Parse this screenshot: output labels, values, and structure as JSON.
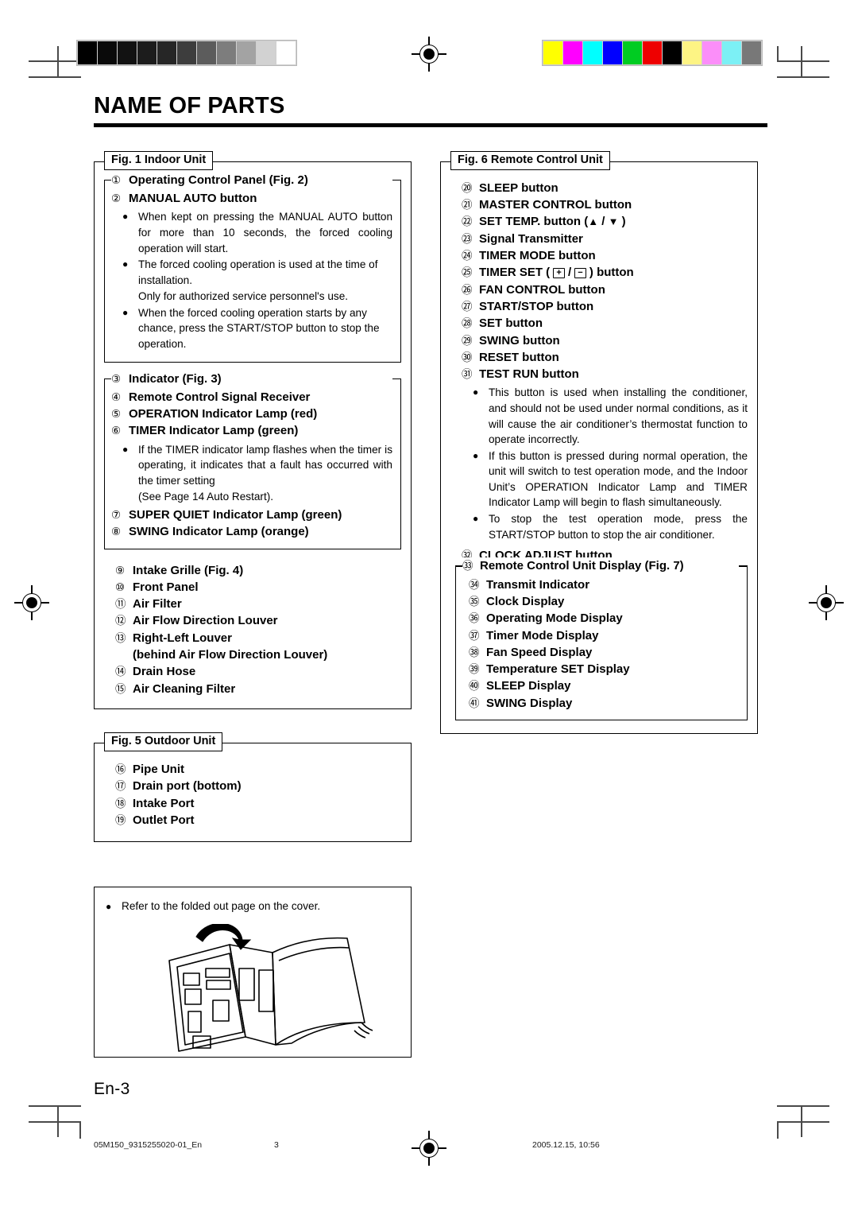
{
  "page": {
    "title": "NAME OF PARTS",
    "folio": "En-3"
  },
  "print_marks": {
    "grayscale_bar": [
      "#000000",
      "#0a0a0a",
      "#121212",
      "#1c1c1c",
      "#262626",
      "#3d3d3d",
      "#5c5c5c",
      "#7d7d7d",
      "#a3a3a3",
      "#d2d2d2",
      "#ffffff"
    ],
    "color_bar": [
      "#ffff00",
      "#ff00ff",
      "#00ffff",
      "#0000ff",
      "#00cc22",
      "#ee0000",
      "#000000",
      "#fdf484",
      "#fb8ef9",
      "#7cf0f5",
      "#787878"
    ],
    "registration_mark": "registration-target-icon"
  },
  "fig1": {
    "legend": "Fig. 1 Indoor Unit",
    "operating_panel": {
      "legend_item": {
        "num": "①",
        "label": "Operating Control Panel (Fig. 2)"
      },
      "items": [
        {
          "num": "②",
          "label": "MANUAL AUTO button"
        }
      ],
      "bullets": [
        "When kept on pressing the MANUAL AUTO button for more than 10 seconds, the forced cooling operation will start.",
        "The forced cooling operation is used at the time of installation.",
        "Only for authorized service personnel's use.",
        "When the forced cooling operation starts by any chance, press the START/STOP button to stop the operation."
      ]
    },
    "indicator": {
      "legend_item": {
        "num": "③",
        "label": "Indicator (Fig. 3)"
      },
      "items": [
        {
          "num": "④",
          "label": "Remote Control Signal Receiver"
        },
        {
          "num": "⑤",
          "label": "OPERATION Indicator Lamp (red)"
        },
        {
          "num": "⑥",
          "label": "TIMER Indicator Lamp (green)"
        }
      ],
      "bullets": [
        "If the TIMER indicator lamp flashes when the timer is operating, it indicates that a fault has occurred with the timer setting",
        "(See Page 14 Auto Restart)."
      ],
      "items_after": [
        {
          "num": "⑦",
          "label": "SUPER QUIET Indicator Lamp (green)"
        },
        {
          "num": "⑧",
          "label": "SWING Indicator Lamp (orange)"
        }
      ]
    },
    "parts": [
      {
        "num": "⑨",
        "label": "Intake Grille (Fig. 4)"
      },
      {
        "num": "⑩",
        "label": "Front Panel"
      },
      {
        "num": "⑪",
        "label": "Air Filter"
      },
      {
        "num": "⑫",
        "label": "Air Flow Direction Louver"
      },
      {
        "num": "⑬",
        "label": "Right-Left Louver"
      },
      {
        "num": "",
        "label": "(behind Air Flow Direction Louver)"
      },
      {
        "num": "⑭",
        "label": "Drain Hose"
      },
      {
        "num": "⑮",
        "label": "Air Cleaning Filter"
      }
    ]
  },
  "fig5": {
    "legend": "Fig. 5 Outdoor Unit",
    "items": [
      {
        "num": "⑯",
        "label": "Pipe Unit"
      },
      {
        "num": "⑰",
        "label": "Drain port (bottom)"
      },
      {
        "num": "⑱",
        "label": "Intake Port"
      },
      {
        "num": "⑲",
        "label": "Outlet Port"
      }
    ]
  },
  "cover_note": {
    "text": "Refer to the folded out page on the cover.",
    "illustration": "open-booklet-illustration"
  },
  "fig6": {
    "legend": "Fig. 6 Remote Control Unit",
    "items": [
      {
        "num": "⑳",
        "label": "SLEEP button"
      },
      {
        "num": "㉑",
        "label": "MASTER CONTROL button"
      },
      {
        "num": "㉒",
        "label": "SET TEMP. button (",
        "suffix": ")",
        "symbols": [
          "▲",
          "/",
          "▼"
        ]
      },
      {
        "num": "㉓",
        "label": "Signal Transmitter"
      },
      {
        "num": "㉔",
        "label": "TIMER MODE button"
      },
      {
        "num": "㉕",
        "label": "TIMER SET (",
        "suffix": ") button",
        "symbols": [
          "+",
          "/",
          "−"
        ]
      },
      {
        "num": "㉖",
        "label": "FAN CONTROL button"
      },
      {
        "num": "㉗",
        "label": "START/STOP button"
      },
      {
        "num": "㉘",
        "label": "SET button"
      },
      {
        "num": "㉙",
        "label": "SWING button"
      },
      {
        "num": "㉚",
        "label": "RESET button"
      },
      {
        "num": "㉛",
        "label": "TEST RUN button"
      }
    ],
    "test_run_bullets": [
      "This button is used when installing the conditioner, and should not be used under normal conditions, as it will cause the air conditioner’s thermostat function to operate incorrectly.",
      "If this button is pressed during normal operation, the unit will switch to test operation mode, and the Indoor Unit’s OPERATION Indicator Lamp and TIMER Indicator Lamp will begin to flash simultaneously.",
      "To stop the test operation mode, press the START/STOP button to stop the air conditioner."
    ],
    "clock_adjust": {
      "num": "㉜",
      "label": "CLOCK ADJUST button"
    },
    "display": {
      "legend_item": {
        "num": "㉝",
        "label": "Remote Control Unit Display (Fig. 7)"
      },
      "items": [
        {
          "num": "㉞",
          "label": "Transmit Indicator"
        },
        {
          "num": "㉟",
          "label": "Clock Display"
        },
        {
          "num": "㊱",
          "label": "Operating Mode Display"
        },
        {
          "num": "㊲",
          "label": "Timer Mode Display"
        },
        {
          "num": "㊳",
          "label": "Fan Speed Display"
        },
        {
          "num": "㊴",
          "label": "Temperature SET Display"
        },
        {
          "num": "㊵",
          "label": "SLEEP Display"
        },
        {
          "num": "㊶",
          "label": "SWING Display"
        }
      ]
    }
  },
  "print_footer": {
    "job_code": "05M150_9315255020-01_En",
    "page_number": "3",
    "timestamp": "2005.12.15, 10:56"
  }
}
